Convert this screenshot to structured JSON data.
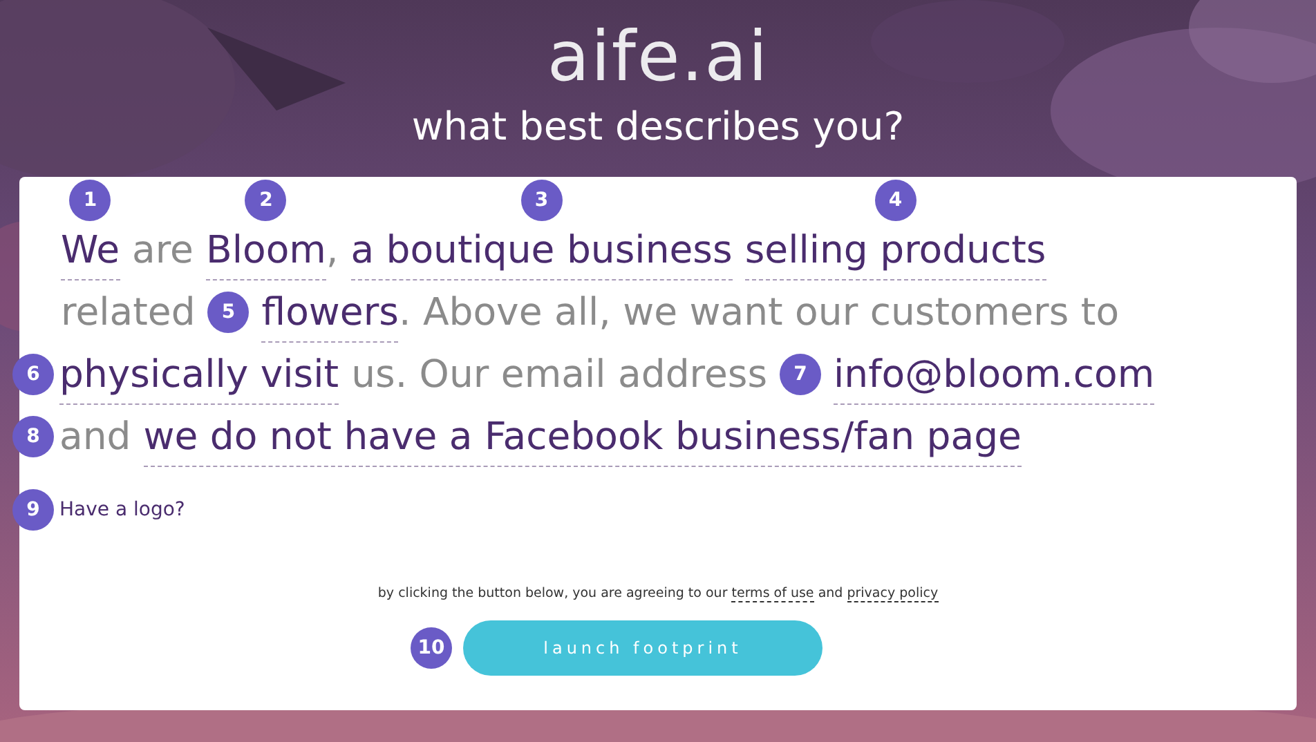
{
  "logo": "aife.ai",
  "heading": "what best describes you?",
  "sentence": [
    [
      {
        "kind": "field",
        "text": "We",
        "marker": "1"
      },
      {
        "kind": "text",
        "text": "are"
      },
      {
        "kind": "field",
        "text": "Bloom",
        "marker": "2"
      },
      {
        "kind": "punct",
        "text": ","
      },
      {
        "kind": "field",
        "text": "a boutique business",
        "marker": "3"
      },
      {
        "kind": "field",
        "text": "selling products",
        "marker": "4"
      }
    ],
    [
      {
        "kind": "text",
        "text": "related"
      },
      {
        "kind": "marker",
        "text": "5"
      },
      {
        "kind": "field",
        "text": "flowers"
      },
      {
        "kind": "punct",
        "text": ". Above all, we want our customers to"
      }
    ],
    [
      {
        "kind": "marker",
        "text": "6"
      },
      {
        "kind": "field",
        "text": "physically visit"
      },
      {
        "kind": "text",
        "text": "us. Our email address"
      },
      {
        "kind": "marker",
        "text": "7"
      },
      {
        "kind": "field",
        "text": "info@bloom.com"
      }
    ],
    [
      {
        "kind": "marker",
        "text": "8"
      },
      {
        "kind": "text",
        "text": "and"
      },
      {
        "kind": "field",
        "text": "we do not have a Facebook business/fan page"
      }
    ]
  ],
  "logo_question": {
    "text": "Have a logo?",
    "marker": "9"
  },
  "agreement": {
    "before": "by clicking the button below, you are agreeing to our",
    "terms": "terms of use",
    "joiner": "and",
    "privacy": "privacy policy"
  },
  "launch": {
    "label": "launch footprint",
    "marker": "10"
  }
}
